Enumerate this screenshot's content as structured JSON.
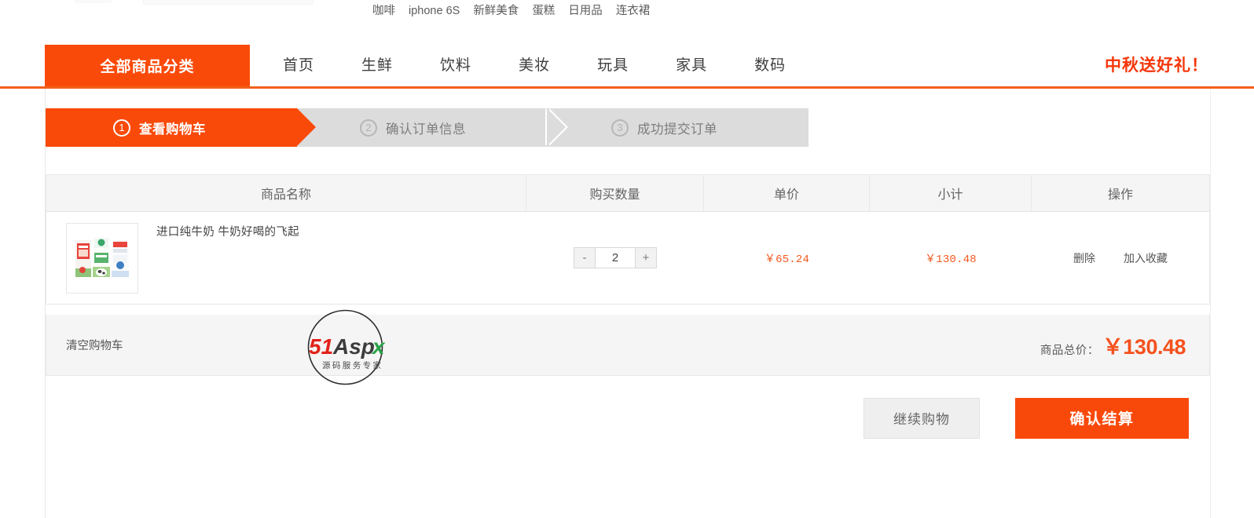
{
  "hot_keywords": [
    {
      "label": "咖啡"
    },
    {
      "label": "iphone 6S"
    },
    {
      "label": "新鲜美食"
    },
    {
      "label": "蛋糕"
    },
    {
      "label": "日用品"
    },
    {
      "label": "连衣裙"
    }
  ],
  "nav": {
    "all_categories": "全部商品分类",
    "links": [
      {
        "label": "首页"
      },
      {
        "label": "生鲜"
      },
      {
        "label": "饮料"
      },
      {
        "label": "美妆"
      },
      {
        "label": "玩具"
      },
      {
        "label": "家具"
      },
      {
        "label": "数码"
      }
    ],
    "promo": "中秋送好礼！"
  },
  "steps": [
    {
      "num": "1",
      "label": "查看购物车",
      "state": "active"
    },
    {
      "num": "2",
      "label": "确认订单信息",
      "state": "inactive"
    },
    {
      "num": "3",
      "label": "成功提交订单",
      "state": "inactive"
    }
  ],
  "cart": {
    "columns": [
      {
        "key": "name",
        "label": "商品名称"
      },
      {
        "key": "qty",
        "label": "购买数量"
      },
      {
        "key": "price",
        "label": "单价"
      },
      {
        "key": "sub",
        "label": "小计"
      },
      {
        "key": "op",
        "label": "操作"
      }
    ],
    "items": [
      {
        "name": "进口纯牛奶 牛奶好喝的飞起",
        "quantity": "2",
        "minus_label": "-",
        "plus_label": "+",
        "unit_price": "￥65.24",
        "subtotal": "￥130.48",
        "delete_label": "删除",
        "favorite_label": "加入收藏"
      }
    ],
    "clear_cart_label": "清空购物车",
    "total_label": "商品总价：",
    "total_amount": "￥130.48"
  },
  "footer_actions": {
    "continue_label": "继续购物",
    "checkout_label": "确认结算"
  },
  "watermark": {
    "brand_51": "51",
    "brand_aspx": "Aspx",
    "tagline": "源码服务专家"
  },
  "colors": {
    "accent_orange": "#fa4a09",
    "promo_red": "#f5360a",
    "price_orange": "#f2591f",
    "total_orange": "#f5511e",
    "step_inactive": "#dcdcdc",
    "header_bg": "#f5f5f5"
  }
}
